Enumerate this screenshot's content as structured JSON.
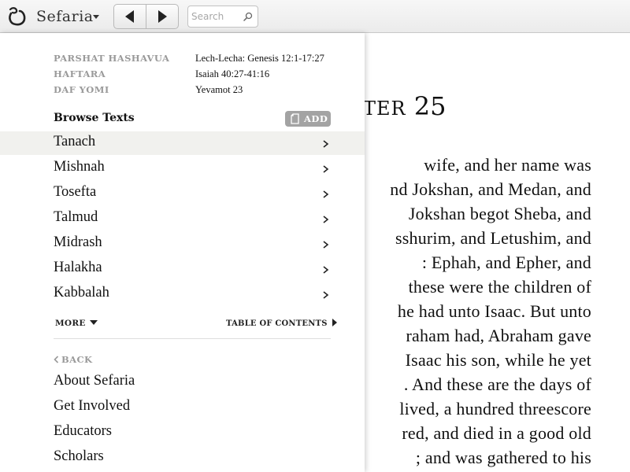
{
  "header": {
    "brand": "Sefaria",
    "search_placeholder": "Search"
  },
  "calendar": [
    {
      "label": "PARSHAT HASHAVUA",
      "value": "Lech-Lecha: Genesis 12:1-17:27"
    },
    {
      "label": "HAFTARA",
      "value": "Isaiah 40:27-41:16"
    },
    {
      "label": "DAF YOMI",
      "value": "Yevamot 23"
    }
  ],
  "browse": {
    "title": "Browse Texts",
    "add_label": "ADD",
    "categories": [
      "Tanach",
      "Mishnah",
      "Tosefta",
      "Talmud",
      "Midrash",
      "Halakha",
      "Kabbalah"
    ],
    "more_label": "MORE",
    "toc_label": "TABLE OF CONTENTS"
  },
  "back_label": "BACK",
  "links": [
    "About Sefaria",
    "Get Involved",
    "Educators",
    "Scholars"
  ],
  "reader": {
    "chapter_word": "TER",
    "chapter_number": "25",
    "lines": [
      "wife, and her name was",
      "nd Jokshan, and Medan, and",
      "Jokshan begot Sheba, and",
      "sshurim, and Letushim, and",
      ": Ephah, and Epher, and",
      "these were the children of",
      "he had unto Isaac. But unto",
      "raham had, Abraham gave",
      "Isaac his son, while he yet",
      ". And these are the days of",
      "lived, a hundred threescore",
      "red, and died in a good old",
      "; and was gathered to his"
    ]
  },
  "colors": {
    "muted_label": "#9a9a9a",
    "active_row": "#f1f1ee",
    "add_button": "#a3a3a3"
  }
}
